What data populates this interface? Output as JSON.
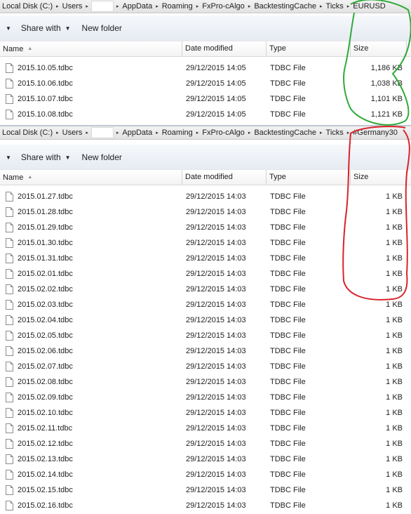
{
  "top": {
    "breadcrumb": [
      "Local Disk (C:)",
      "Users",
      "",
      "AppData",
      "Roaming",
      "FxPro-cAlgo",
      "BacktestingCache",
      "Ticks",
      "EURUSD"
    ],
    "toolbar": {
      "share": "Share with",
      "newfolder": "New folder"
    },
    "columns": {
      "name": "Name",
      "date": "Date modified",
      "type": "Type",
      "size": "Size"
    },
    "files": [
      {
        "name": "2015.10.05.tdbc",
        "date": "29/12/2015 14:05",
        "type": "TDBC File",
        "size": "1,186 KB"
      },
      {
        "name": "2015.10.06.tdbc",
        "date": "29/12/2015 14:05",
        "type": "TDBC File",
        "size": "1,038 KB"
      },
      {
        "name": "2015.10.07.tdbc",
        "date": "29/12/2015 14:05",
        "type": "TDBC File",
        "size": "1,101 KB"
      },
      {
        "name": "2015.10.08.tdbc",
        "date": "29/12/2015 14:05",
        "type": "TDBC File",
        "size": "1,121 KB"
      }
    ]
  },
  "bottom": {
    "breadcrumb": [
      "Local Disk (C:)",
      "Users",
      "",
      "AppData",
      "Roaming",
      "FxPro-cAlgo",
      "BacktestingCache",
      "Ticks",
      "#Germany30"
    ],
    "toolbar": {
      "share": "Share with",
      "newfolder": "New folder"
    },
    "columns": {
      "name": "Name",
      "date": "Date modified",
      "type": "Type",
      "size": "Size"
    },
    "files": [
      {
        "name": "2015.01.27.tdbc",
        "date": "29/12/2015 14:03",
        "type": "TDBC File",
        "size": "1 KB"
      },
      {
        "name": "2015.01.28.tdbc",
        "date": "29/12/2015 14:03",
        "type": "TDBC File",
        "size": "1 KB"
      },
      {
        "name": "2015.01.29.tdbc",
        "date": "29/12/2015 14:03",
        "type": "TDBC File",
        "size": "1 KB"
      },
      {
        "name": "2015.01.30.tdbc",
        "date": "29/12/2015 14:03",
        "type": "TDBC File",
        "size": "1 KB"
      },
      {
        "name": "2015.01.31.tdbc",
        "date": "29/12/2015 14:03",
        "type": "TDBC File",
        "size": "1 KB"
      },
      {
        "name": "2015.02.01.tdbc",
        "date": "29/12/2015 14:03",
        "type": "TDBC File",
        "size": "1 KB"
      },
      {
        "name": "2015.02.02.tdbc",
        "date": "29/12/2015 14:03",
        "type": "TDBC File",
        "size": "1 KB"
      },
      {
        "name": "2015.02.03.tdbc",
        "date": "29/12/2015 14:03",
        "type": "TDBC File",
        "size": "1 KB"
      },
      {
        "name": "2015.02.04.tdbc",
        "date": "29/12/2015 14:03",
        "type": "TDBC File",
        "size": "1 KB"
      },
      {
        "name": "2015.02.05.tdbc",
        "date": "29/12/2015 14:03",
        "type": "TDBC File",
        "size": "1 KB"
      },
      {
        "name": "2015.02.06.tdbc",
        "date": "29/12/2015 14:03",
        "type": "TDBC File",
        "size": "1 KB"
      },
      {
        "name": "2015.02.07.tdbc",
        "date": "29/12/2015 14:03",
        "type": "TDBC File",
        "size": "1 KB"
      },
      {
        "name": "2015.02.08.tdbc",
        "date": "29/12/2015 14:03",
        "type": "TDBC File",
        "size": "1 KB"
      },
      {
        "name": "2015.02.09.tdbc",
        "date": "29/12/2015 14:03",
        "type": "TDBC File",
        "size": "1 KB"
      },
      {
        "name": "2015.02.10.tdbc",
        "date": "29/12/2015 14:03",
        "type": "TDBC File",
        "size": "1 KB"
      },
      {
        "name": "2015.02.11.tdbc",
        "date": "29/12/2015 14:03",
        "type": "TDBC File",
        "size": "1 KB"
      },
      {
        "name": "2015.02.12.tdbc",
        "date": "29/12/2015 14:03",
        "type": "TDBC File",
        "size": "1 KB"
      },
      {
        "name": "2015.02.13.tdbc",
        "date": "29/12/2015 14:03",
        "type": "TDBC File",
        "size": "1 KB"
      },
      {
        "name": "2015.02.14.tdbc",
        "date": "29/12/2015 14:03",
        "type": "TDBC File",
        "size": "1 KB"
      },
      {
        "name": "2015.02.15.tdbc",
        "date": "29/12/2015 14:03",
        "type": "TDBC File",
        "size": "1 KB"
      },
      {
        "name": "2015.02.16.tdbc",
        "date": "29/12/2015 14:03",
        "type": "TDBC File",
        "size": "1 KB"
      }
    ]
  },
  "icons": {
    "file": "file-icon",
    "chevron": "chevron-down-icon",
    "sort": "sort-up-icon"
  },
  "colors": {
    "annotation_green": "#2eaa3a",
    "annotation_red": "#d8232a"
  }
}
